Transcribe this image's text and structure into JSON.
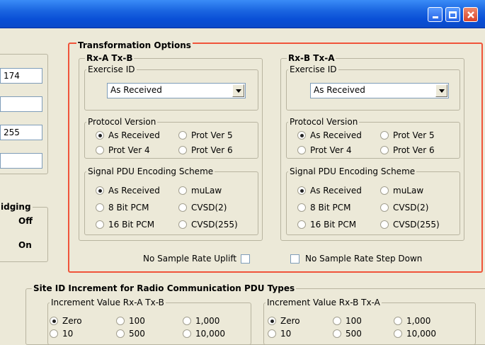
{
  "window": {
    "buttons": [
      "minimize-icon",
      "maximize-icon",
      "close-icon"
    ]
  },
  "left": {
    "field1": "174",
    "field2": "",
    "field3": "255",
    "field4": "",
    "bridging": {
      "label": "idging",
      "off": "Off",
      "on": "On"
    }
  },
  "transformation": {
    "title": "Transformation Options",
    "rxa": {
      "title": "Rx-A  Tx-B",
      "exercise_label": "Exercise ID",
      "exercise_value": "As Received",
      "protocol_label": "Protocol Version",
      "protocol_options": [
        "As Received",
        "Prot Ver 5",
        "Prot Ver 4",
        "Prot Ver 6"
      ],
      "protocol_selected": "As Received",
      "encoding_label": "Signal PDU Encoding Scheme",
      "encoding_options": [
        "As Received",
        "muLaw",
        "8 Bit PCM",
        "CVSD(2)",
        "16 Bit PCM",
        "CVSD(255)"
      ],
      "encoding_selected": "As Received"
    },
    "rxb": {
      "title": "Rx-B  Tx-A",
      "exercise_label": "Exercise ID",
      "exercise_value": "As Received",
      "protocol_label": "Protocol Version",
      "protocol_options": [
        "As Received",
        "Prot Ver 5",
        "Prot Ver 4",
        "Prot Ver 6"
      ],
      "protocol_selected": "As Received",
      "encoding_label": "Signal PDU Encoding Scheme",
      "encoding_options": [
        "As Received",
        "muLaw",
        "8 Bit PCM",
        "CVSD(2)",
        "16 Bit PCM",
        "CVSD(255)"
      ],
      "encoding_selected": "As Received"
    },
    "no_uplift_label": "No Sample Rate Uplift",
    "no_uplift_checked": false,
    "no_stepdown_label": "No Sample Rate Step Down",
    "no_stepdown_checked": false
  },
  "site_increment": {
    "title": "Site ID Increment for Radio Communication PDU Types",
    "rxa": {
      "label": "Increment Value Rx-A  Tx-B",
      "options": [
        "Zero",
        "100",
        "1,000",
        "10",
        "500",
        "10,000"
      ],
      "selected": "Zero"
    },
    "rxb": {
      "label": "Increment Value Rx-B  Tx-A",
      "options": [
        "Zero",
        "100",
        "1,000",
        "10",
        "500",
        "10,000"
      ],
      "selected": "Zero"
    }
  }
}
